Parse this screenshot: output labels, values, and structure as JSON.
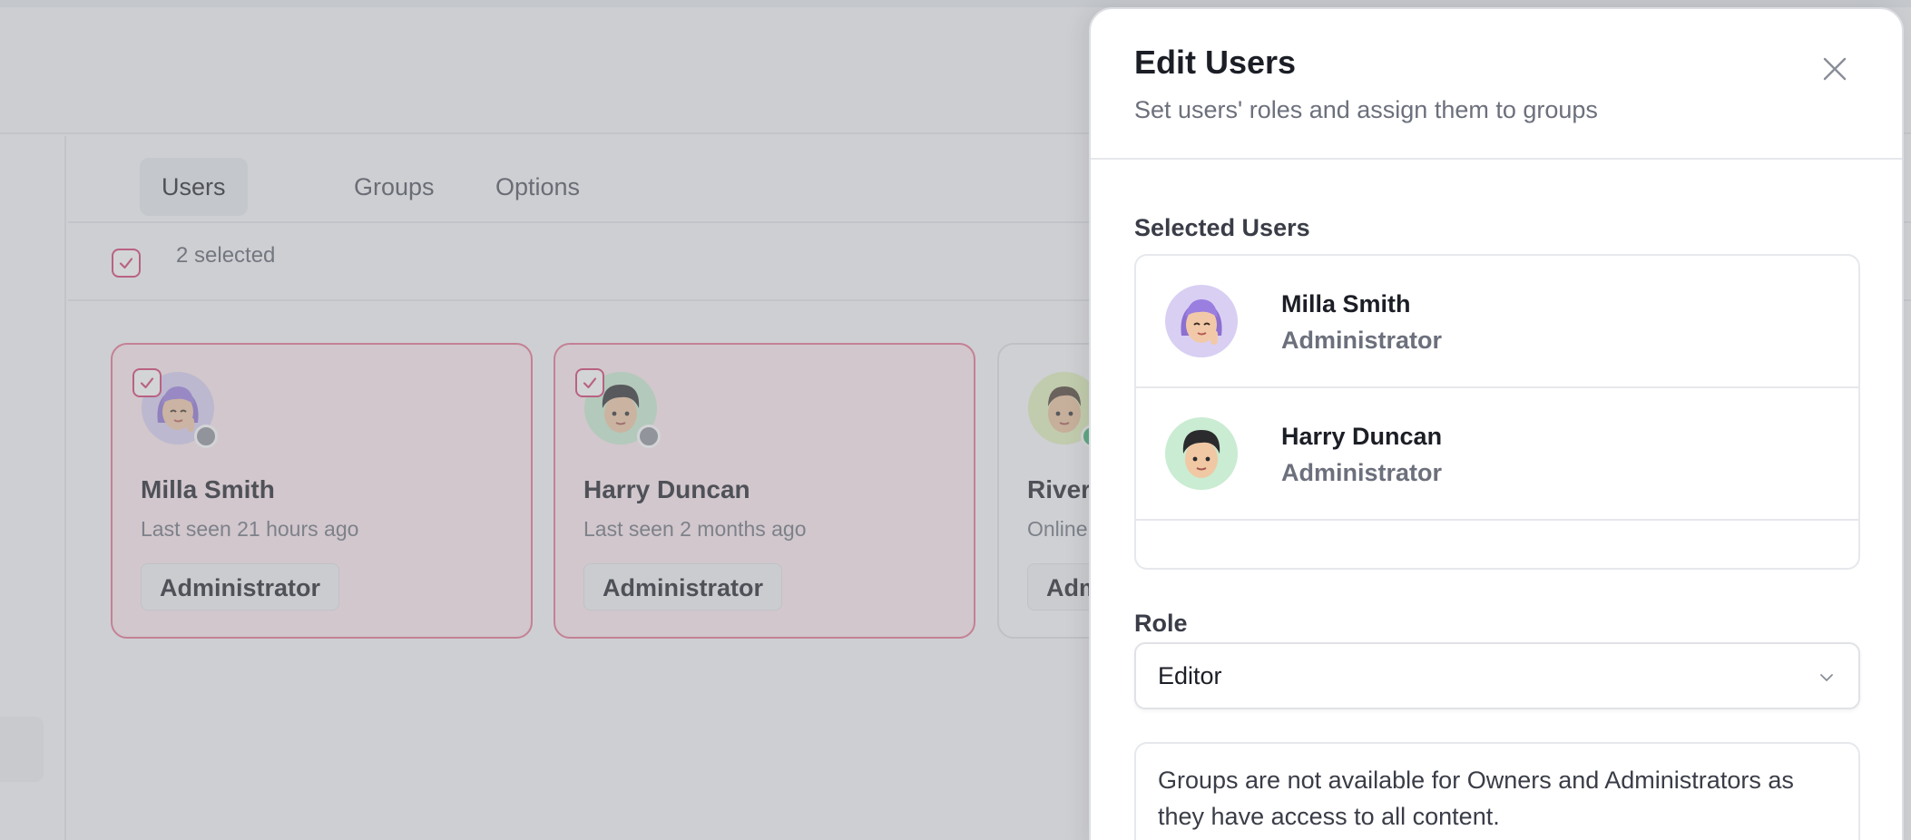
{
  "tabs": [
    {
      "label": "Users"
    },
    {
      "label": "Groups"
    },
    {
      "label": "Options"
    }
  ],
  "selection": {
    "count_text": "2 selected"
  },
  "cards": [
    {
      "name": "Milla Smith",
      "last_seen": "Last seen 21 hours ago",
      "role": "Administrator",
      "selected": true,
      "status_color": "#8e9199"
    },
    {
      "name": "Harry Duncan",
      "last_seen": "Last seen 2 months ago",
      "role": "Administrator",
      "selected": true,
      "status_color": "#8e9199"
    },
    {
      "name": "River",
      "last_seen": "Online",
      "role": "Adm",
      "selected": false,
      "status_color": "#3bb273"
    }
  ],
  "drawer": {
    "title": "Edit Users",
    "subtitle": "Set users' roles and assign them to groups",
    "selected_label": "Selected Users",
    "users": [
      {
        "name": "Milla Smith",
        "role": "Administrator"
      },
      {
        "name": "Harry Duncan",
        "role": "Administrator"
      }
    ],
    "role_label": "Role",
    "role_value": "Editor",
    "info_text": "Groups are not available for Owners and Administrators as they have access to all content."
  },
  "colors": {
    "accent": "#d23c6e",
    "selected_card_bg": "#fbe8ee",
    "avatar_purple": "#d8cff3",
    "avatar_green": "#c9ecd2",
    "avatar_lime": "#e0efb8"
  },
  "icons": [
    "check-icon",
    "close-icon",
    "chevron-down-icon"
  ]
}
